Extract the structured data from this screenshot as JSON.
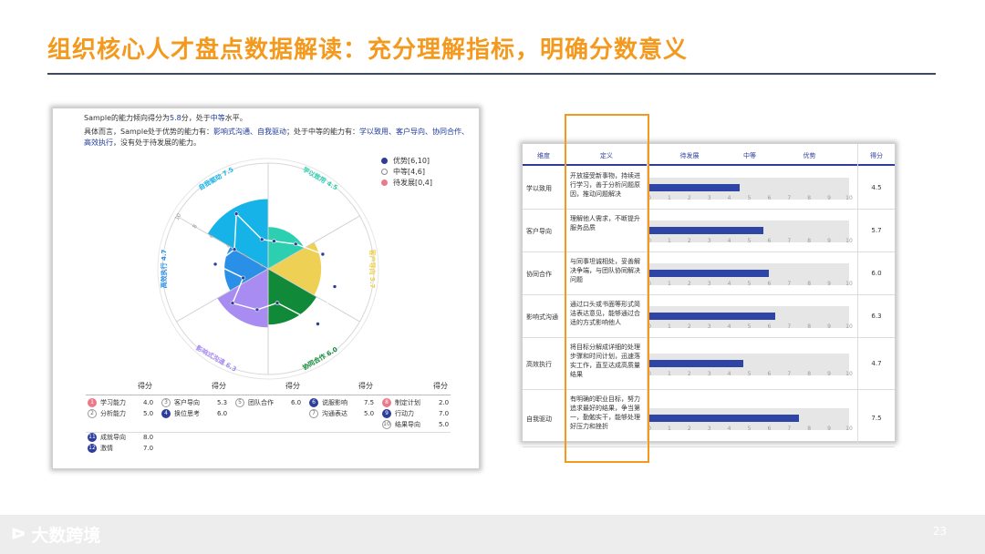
{
  "title": "组织核心人才盘点数据解读：充分理解指标，明确分数意义",
  "summary": {
    "line1_pre": "Sample的能力倾向得分为",
    "line1_score": "5.8",
    "line1_mid": "分，处于",
    "line1_level": "中等",
    "line1_post": "水平。",
    "line2_pre": "具体而言，Sample处于优势的能力有：",
    "line2_strong": "影响式沟通、自我驱动",
    "line2_mid": "；处于中等的能力有：",
    "line2_middle": "学以致用、客户导向、协同合作、",
    "line3_middle": "高效执行",
    "line3_post": "，没有处于待发展的能力。"
  },
  "legend": [
    {
      "label": "优势[6,10]",
      "color": "#2e3d99",
      "style": "filled"
    },
    {
      "label": "中等[4,6]",
      "color": "#ffffff",
      "style": "outline"
    },
    {
      "label": "待发展[0,4]",
      "color": "#ea7a8a",
      "style": "filled"
    }
  ],
  "chart_data": [
    {
      "type": "rose",
      "ticks": [
        "0",
        "2",
        "4",
        "6",
        "8",
        "10"
      ],
      "series": [
        {
          "name": "学以致用",
          "value": 4.5,
          "color": "#2dcfb1",
          "label": "学以致用 4.5"
        },
        {
          "name": "客户导向",
          "value": 5.7,
          "color": "#eed154",
          "label": "客户导向 5.7"
        },
        {
          "name": "协同合作",
          "value": 6.0,
          "color": "#108a38",
          "label": "协同合作 6.0"
        },
        {
          "name": "影响式沟通",
          "value": 6.3,
          "color": "#a88cf2",
          "label": "影响式沟通 6.3"
        },
        {
          "name": "高效执行",
          "value": 4.7,
          "color": "#2a8fe6",
          "label": "高效执行 4.7"
        },
        {
          "name": "自我驱动",
          "value": 7.5,
          "color": "#16b3e8",
          "label": "自我驱动 7.5"
        }
      ]
    },
    {
      "type": "bar",
      "xlim": [
        0,
        10
      ],
      "ticks": [
        "0",
        "1",
        "2",
        "3",
        "4",
        "5",
        "6",
        "7",
        "8",
        "9",
        "10"
      ],
      "categories": [
        "学以致用",
        "客户导向",
        "协同合作",
        "影响式沟通",
        "高效执行",
        "自我驱动"
      ],
      "values": [
        4.5,
        5.7,
        6.0,
        6.3,
        4.7,
        7.5
      ]
    }
  ],
  "scores": {
    "head": "得分",
    "items": [
      {
        "n": "1",
        "name": "学习能力",
        "value": "4.0",
        "level": "weak"
      },
      {
        "n": "2",
        "name": "分析能力",
        "value": "5.0",
        "level": "mid"
      },
      {
        "n": "3",
        "name": "客户导向",
        "value": "5.3",
        "level": "mid"
      },
      {
        "n": "4",
        "name": "换位思考",
        "value": "6.0",
        "level": "strong"
      },
      {
        "n": "5",
        "name": "团队合作",
        "value": "6.0",
        "level": "mid"
      },
      {
        "n": "6",
        "name": "说服影响",
        "value": "7.5",
        "level": "strong"
      },
      {
        "n": "7",
        "name": "沟通表达",
        "value": "5.0",
        "level": "mid"
      },
      {
        "n": "8",
        "name": "制定计划",
        "value": "2.0",
        "level": "weak"
      },
      {
        "n": "9",
        "name": "行动力",
        "value": "7.0",
        "level": "strong"
      },
      {
        "n": "10",
        "name": "结果导向",
        "value": "5.0",
        "level": "mid"
      },
      {
        "n": "11",
        "name": "成就导向",
        "value": "8.0",
        "level": "strong"
      },
      {
        "n": "12",
        "name": "激情",
        "value": "7.0",
        "level": "strong"
      }
    ]
  },
  "table": {
    "headers": {
      "dim": "维度",
      "def": "定义",
      "low": "待发展",
      "mid": "中等",
      "high": "优势",
      "score": "得分"
    },
    "rows": [
      {
        "dim": "学以致用",
        "def": "开放接受新事物，持续进行学习，善于分析问题原因，推动问题解决",
        "value": 4.5,
        "score": "4.5"
      },
      {
        "dim": "客户导向",
        "def": "理解他人需求，不断提升服务品质",
        "value": 5.7,
        "score": "5.7"
      },
      {
        "dim": "协同合作",
        "def": "与同事坦诚相处，妥善解决争端，与团队协同解决问题",
        "value": 6.0,
        "score": "6.0"
      },
      {
        "dim": "影响式沟通",
        "def": "通过口头或书面等形式简洁表达意见，能够通过合适的方式影响他人",
        "value": 6.3,
        "score": "6.3"
      },
      {
        "dim": "高效执行",
        "def": "将目标分解成详细的处理步骤和时间计划，迅速落实工作，直至达成高质量结果",
        "value": 4.7,
        "score": "4.7"
      },
      {
        "dim": "自我驱动",
        "def": "有明确的职业目标，努力追求最好的结果，争当第一，勤勉实干，能够处理好压力和挫折",
        "value": 7.5,
        "score": "7.5"
      }
    ]
  },
  "footer": {
    "brand": "大数跨境",
    "mark": "ᐅ",
    "page": "23"
  }
}
